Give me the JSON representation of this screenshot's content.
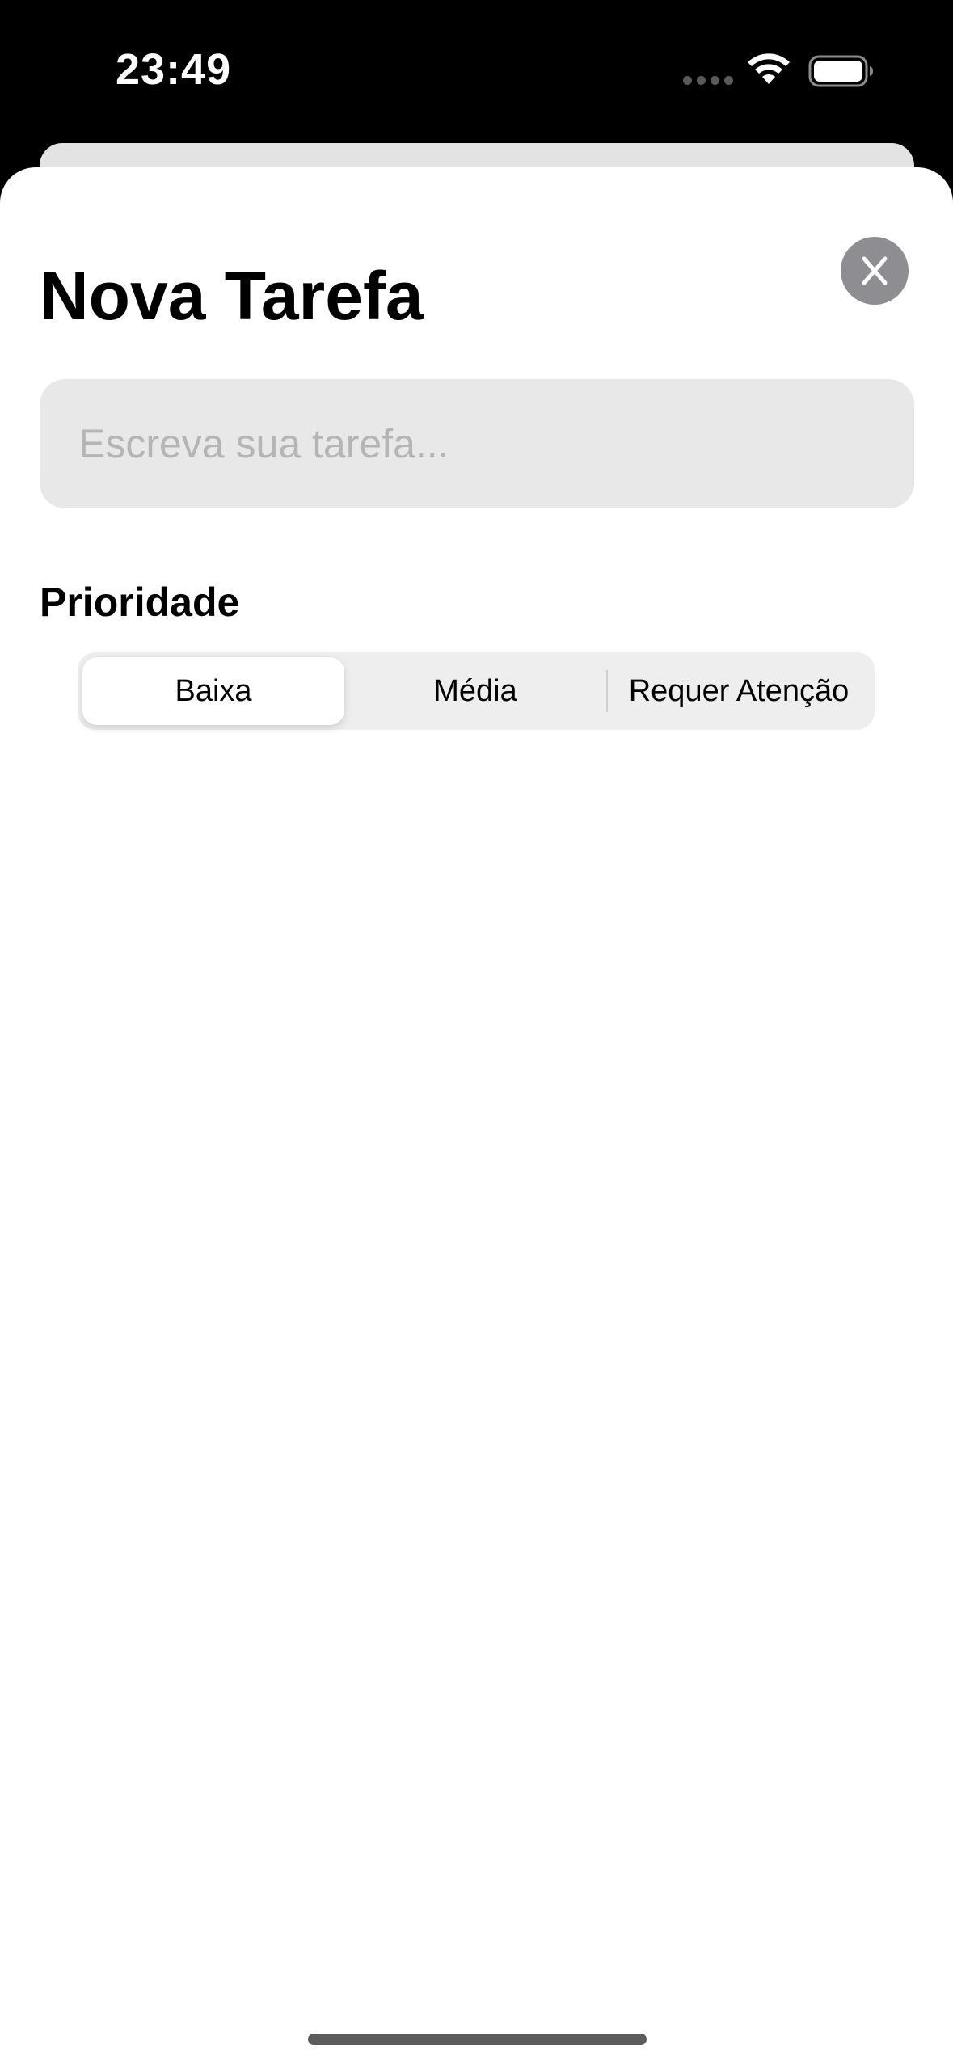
{
  "status_bar": {
    "time": "23:49"
  },
  "sheet": {
    "title": "Nova Tarefa",
    "close_label": "X",
    "task_input": {
      "value": "",
      "placeholder": "Escreva sua tarefa..."
    },
    "priority": {
      "label": "Prioridade",
      "options": [
        "Baixa",
        "Média",
        "Requer Atenção"
      ],
      "selected": "Baixa"
    }
  },
  "colors": {
    "sheet_background": "#ffffff",
    "input_background": "#e8e8e8",
    "close_button": "#8e8e92",
    "segmented_background": "#eeeeef"
  }
}
